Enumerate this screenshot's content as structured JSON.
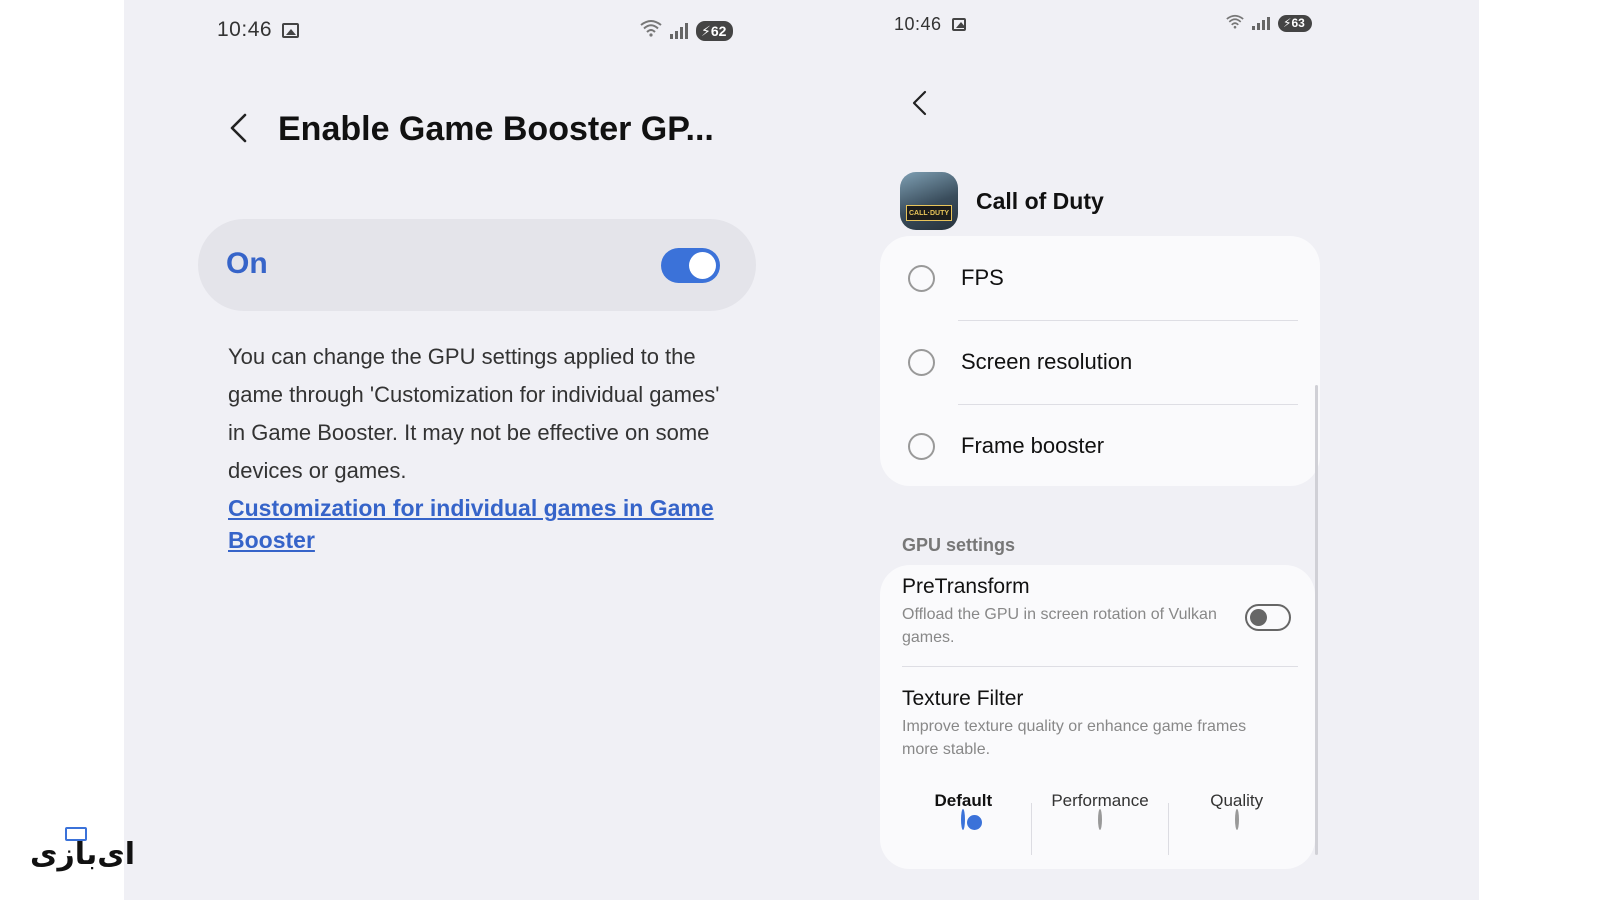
{
  "colors": {
    "accent": "#3b72d9",
    "background": "#f0f0f5",
    "card": "#fafafc"
  },
  "left_phone": {
    "status_bar": {
      "time": "10:46",
      "battery": "62",
      "icons": [
        "gallery-icon",
        "wifi-icon",
        "signal-icon",
        "battery-icon"
      ]
    },
    "title": "Enable Game Booster GP...",
    "toggle_label": "On",
    "toggle_state": true,
    "description": "You can change the GPU settings applied to the game through 'Customization for individual games' in Game Booster. It may not be effective on some devices or games.",
    "link": "Customization for individual games in Game Booster"
  },
  "right_phone": {
    "status_bar": {
      "time": "10:46",
      "battery": "63"
    },
    "game_name": "Call of Duty",
    "game_icon_text": "CALL·DUTY",
    "options": [
      "FPS",
      "Screen resolution",
      "Frame booster"
    ],
    "gpu_section_label": "GPU settings",
    "pretransform": {
      "title": "PreTransform",
      "subtitle": "Offload the GPU in screen rotation of Vulkan games.",
      "enabled": false
    },
    "texture_filter": {
      "title": "Texture Filter",
      "subtitle": "Improve texture quality or enhance game frames more stable.",
      "choices": [
        "Default",
        "Performance",
        "Quality"
      ],
      "selected": "Default"
    }
  },
  "watermark": {
    "text": "ای‌بازی"
  }
}
